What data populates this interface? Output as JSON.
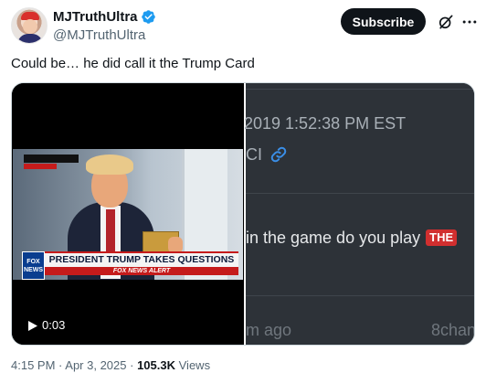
{
  "author": {
    "display_name": "MJTruthUltra",
    "handle": "@MJTruthUltra",
    "verified_color": "#1d9bf0"
  },
  "actions": {
    "subscribe_label": "Subscribe"
  },
  "tweet": {
    "text": "Could be… he did call it the Trump Card"
  },
  "video": {
    "duration": "0:03",
    "lower_third_logo": "FOX NEWS",
    "headline": "PRESIDENT TRUMP TAKES QUESTIONS",
    "alert": "FOX NEWS ALERT"
  },
  "post_screenshot": {
    "date_fragment": "2019 1:52:38 PM EST",
    "id_fragment": "CI",
    "message_fragment": "in the game do you play",
    "badge": "THE",
    "age_fragment": "m ago",
    "source_fragment": "8chan"
  },
  "meta": {
    "time": "4:15 PM",
    "date": "Apr 3, 2025",
    "views_count": "105.3K",
    "views_label": "Views"
  }
}
